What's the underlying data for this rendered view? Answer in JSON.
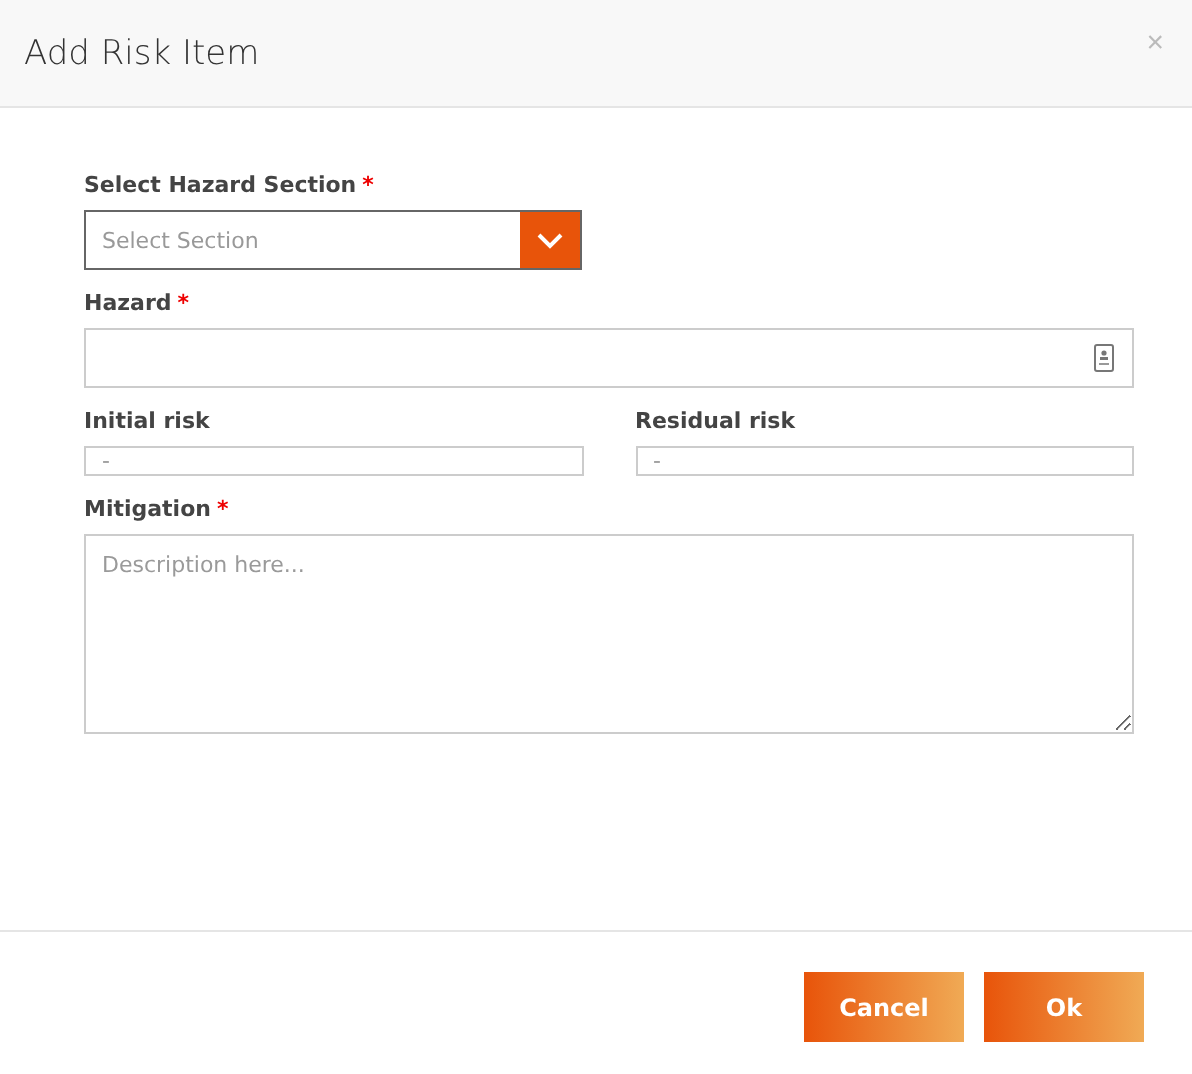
{
  "dialog": {
    "title": "Add Risk Item",
    "close": "×"
  },
  "fields": [
    {
      "kind": "select",
      "label": "Select Hazard Section",
      "required_mark": "*",
      "placeholder": "Select Section"
    },
    {
      "kind": "text-icon",
      "label": "Hazard",
      "required_mark": "*"
    },
    {
      "kind": "pair",
      "items": [
        {
          "label": "Initial risk",
          "placeholder": "-"
        },
        {
          "label": "Residual risk",
          "placeholder": "-"
        }
      ]
    },
    {
      "kind": "textarea",
      "label": "Mitigation",
      "required_mark": "*",
      "placeholder": "Description here..."
    }
  ],
  "buttons": [
    "Cancel",
    "Ok"
  ]
}
